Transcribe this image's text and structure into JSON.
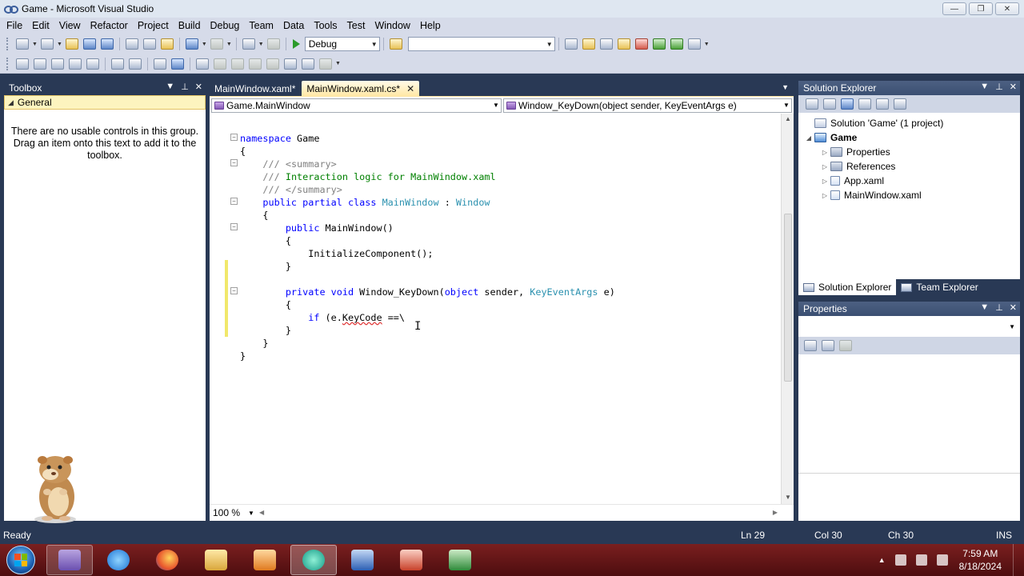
{
  "window": {
    "title": "Game - Microsoft Visual Studio",
    "minimize": "—",
    "maximize": "❐",
    "close": "✕"
  },
  "menu": [
    "File",
    "Edit",
    "View",
    "Refactor",
    "Project",
    "Build",
    "Debug",
    "Team",
    "Data",
    "Tools",
    "Test",
    "Window",
    "Help"
  ],
  "toolbar": {
    "config": "Debug",
    "platform": ""
  },
  "toolbox": {
    "title": "Toolbox",
    "group": "General",
    "message": "There are no usable controls in this group. Drag an item onto this text to add it to the toolbox."
  },
  "editor": {
    "tabs": [
      {
        "label": "MainWindow.xaml*",
        "active": false
      },
      {
        "label": "MainWindow.xaml.cs*",
        "active": true
      }
    ],
    "type_dropdown": "Game.MainWindow",
    "member_dropdown": "Window_KeyDown(object sender, KeyEventArgs e)",
    "zoom": "100 %",
    "lines": [
      "namespace Game",
      "{",
      "    /// <summary>",
      "    /// Interaction logic for MainWindow.xaml",
      "    /// </summary>",
      "    public partial class MainWindow : Window",
      "    {",
      "        public MainWindow()",
      "        {",
      "            InitializeComponent();",
      "        }",
      "",
      "        private void Window_KeyDown(object sender, KeyEventArgs e)",
      "        {",
      "            if (e.KeyCode ==\\",
      "        }",
      "    }",
      "}"
    ]
  },
  "solution_explorer": {
    "title": "Solution Explorer",
    "solution": "Solution 'Game' (1 project)",
    "project": "Game",
    "items": [
      "Properties",
      "References",
      "App.xaml",
      "MainWindow.xaml"
    ],
    "tabs": [
      "Solution Explorer",
      "Team Explorer"
    ]
  },
  "properties": {
    "title": "Properties"
  },
  "status": {
    "ready": "Ready",
    "ln": "Ln 29",
    "col": "Col 30",
    "ch": "Ch 30",
    "ins": "INS"
  },
  "taskbar": {
    "time": "7:59 AM",
    "date": "8/18/2024",
    "apps": [
      "visual-studio",
      "internet-explorer",
      "firefox",
      "file-explorer",
      "media-player",
      "edge-globe",
      "word",
      "powerpoint",
      "excel"
    ]
  },
  "colors": {
    "keyword": "#0000ff",
    "comment": "#008000",
    "type": "#2b91af",
    "chrome": "#293955"
  }
}
